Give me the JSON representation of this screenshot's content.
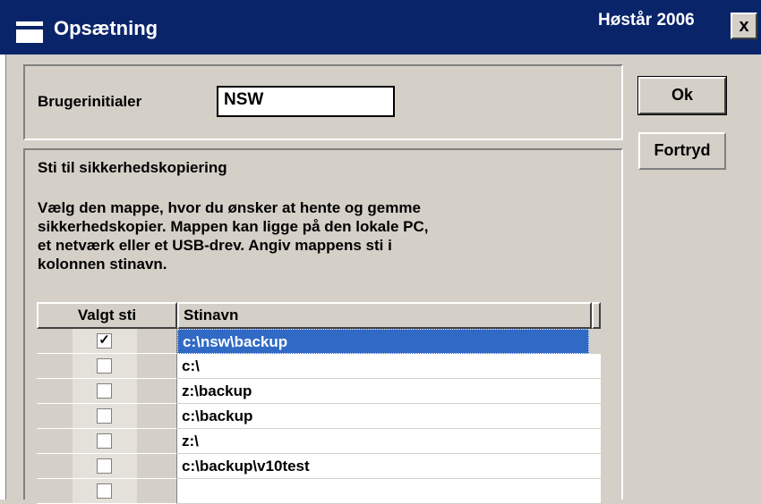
{
  "window": {
    "title": "Opsætning",
    "season": "Høstår 2006",
    "close_label": "x"
  },
  "initials": {
    "label": "Brugerinitialer",
    "value": "NSW"
  },
  "backup": {
    "heading": "Sti til sikkerhedskopiering",
    "description": "Vælg den mappe, hvor du ønsker at hente og gemme\nsikkerhedskopier. Mappen kan ligge på den lokale PC,\net netværk eller et USB-drev. Angiv mappens sti i\nkolonnen stinavn.",
    "columns": [
      "Valgt sti",
      "Stinavn"
    ],
    "rows": [
      {
        "checked": true,
        "path": "c:\\nsw\\backup"
      },
      {
        "checked": false,
        "path": "c:\\"
      },
      {
        "checked": false,
        "path": "z:\\backup"
      },
      {
        "checked": false,
        "path": "c:\\backup"
      },
      {
        "checked": false,
        "path": "z:\\"
      },
      {
        "checked": false,
        "path": "c:\\backup\\v10test"
      },
      {
        "checked": false,
        "path": ""
      }
    ]
  },
  "buttons": {
    "ok_label": "Ok",
    "cancel_label": "Fortryd"
  },
  "icons": {
    "window": "window-icon",
    "close": "close-icon",
    "check": "checkmark-icon"
  }
}
